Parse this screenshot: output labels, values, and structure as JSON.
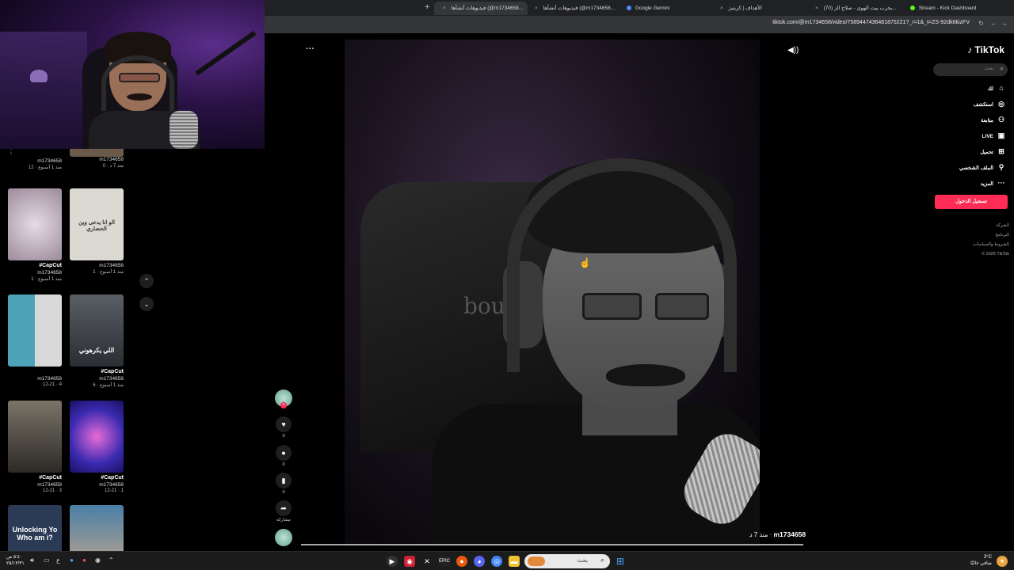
{
  "browser": {
    "tabs": [
      {
        "label": "Stream - Kick Dashboard",
        "color": "#53fc18"
      },
      {
        "label": "(70) يخرب بيت الهوى - صلاح الز...",
        "color": "#ff0000"
      },
      {
        "label": "الأهداف | كريتيز",
        "color": "#7b61ff"
      },
      {
        "label": "Google Gemini",
        "color": "#4f8cf7"
      },
      {
        "label": "فيديوهات أنشأها (@m1734658...",
        "color": "#ffffff"
      },
      {
        "label": "فيديوهات أنشأها (@m1734658...",
        "color": "#ffffff"
      }
    ],
    "url": "tiktok.com/@m1734658/video/7589447436481875221?_r=1&_t=ZS-92dkttkizFV"
  },
  "tiktok": {
    "logo": "TikTok",
    "search_placeholder": "بحث",
    "nav": [
      {
        "label": "لك",
        "icon": "home-icon",
        "glyph": "⌂"
      },
      {
        "label": "استكشف",
        "icon": "compass-icon",
        "glyph": "◎"
      },
      {
        "label": "متابعة",
        "icon": "user-plus-icon",
        "glyph": "⚇"
      },
      {
        "label": "LIVE",
        "icon": "live-icon",
        "glyph": "▣"
      },
      {
        "label": "تحميل",
        "icon": "upload-icon",
        "glyph": "⊞"
      },
      {
        "label": "الملف الشخصي",
        "icon": "profile-icon",
        "glyph": "⚲"
      },
      {
        "label": "المزيد",
        "icon": "more-icon",
        "glyph": "···"
      }
    ],
    "login_button": "تسجيل الدخول",
    "footer": [
      "الشركة",
      "البرنامج",
      "الشروط والسياسات",
      "© 2025 TikTok"
    ]
  },
  "video": {
    "username": "m1734658",
    "time": "منذ 7 د",
    "likes": "0",
    "comments": "0",
    "saves": "0",
    "share_label": "مشاركة",
    "chair_text": "bou"
  },
  "grid": [
    {
      "title": "",
      "user": "m1734658",
      "meta": "منذ 1 أسبوع · 12",
      "color": "#3a2f28",
      "caption": ""
    },
    {
      "title": "",
      "user": "m1734658",
      "meta": "منذ 7 د · 0",
      "color": "#6b5a4a",
      "caption": ""
    },
    {
      "title": "#CapCut",
      "user": "m1734658",
      "meta": "منذ 1 أسبوع · 1",
      "color": "#b9a6b3",
      "caption": ""
    },
    {
      "title": "",
      "user": "m1734658",
      "meta": "منذ 1 أسبوع · 1",
      "color": "#dcd8d2",
      "caption": "الو انا يدعى وين الحضاري"
    },
    {
      "title": "",
      "user": "m1734658",
      "meta": "12-21 · 4",
      "color": "#4fa3b8",
      "caption": ""
    },
    {
      "title": "#CapCut",
      "user": "m1734658",
      "meta": "منذ 1 أسبوع · 6",
      "color": "#3b3f45",
      "caption": "اللي يكرهوني"
    },
    {
      "title": "#CapCut",
      "user": "m1734658",
      "meta": "12-21 · 3",
      "color": "#2d2a26",
      "caption": ""
    },
    {
      "title": "#CapCut",
      "user": "m1734658",
      "meta": "12-21 · 1",
      "color": "#5a3ad8",
      "caption": ""
    },
    {
      "title": "",
      "user": "",
      "meta": "",
      "color": "#2b3a55",
      "caption": "Unlocking Yo Who am i?"
    },
    {
      "title": "",
      "user": "",
      "meta": "",
      "color": "#4a7fa8",
      "caption": ""
    }
  ],
  "taskbar": {
    "search_placeholder": "بحث",
    "clock_time": "٥:٤٠ ص",
    "clock_date": "٢٥/١٢/٣١",
    "weather_temp": "3°C",
    "weather_desc": "صافي غالبًا",
    "lang": "ع"
  }
}
